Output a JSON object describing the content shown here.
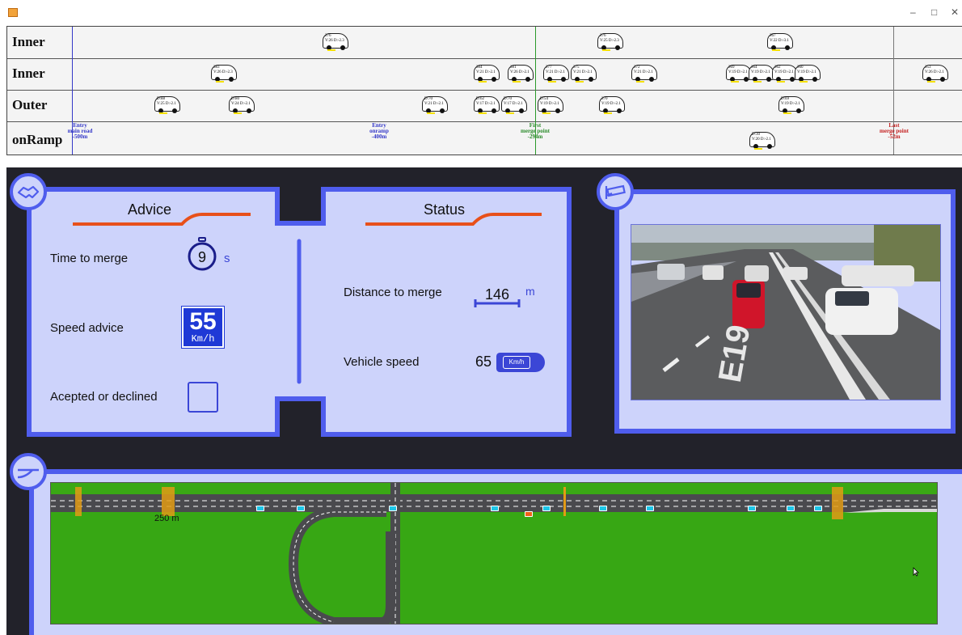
{
  "window": {
    "controls": [
      "–",
      "□",
      "✕"
    ]
  },
  "lanes": {
    "labels": [
      "Inner",
      "Inner",
      "Outer",
      "onRamp"
    ],
    "markers": [
      {
        "lines": [
          "Entry",
          "main road",
          "-500m"
        ],
        "color": "#3438c8"
      },
      {
        "lines": [
          "Entry",
          "onramp",
          "-400m"
        ],
        "color": "#3438c8"
      },
      {
        "lines": [
          "First",
          "merge point",
          "-294m"
        ],
        "color": "#2a8a2a"
      },
      {
        "lines": [
          "Last",
          "merge point",
          "-52m"
        ],
        "color": "#c42020"
      }
    ],
    "cars": [
      {
        "lane": 0,
        "l1": "376",
        "l2": "V:26 D:-2.3"
      },
      {
        "lane": 0,
        "l1": "376",
        "l2": "V:25 D:-2.3"
      },
      {
        "lane": 0,
        "l1": "367",
        "l2": "V:22 D:-3.1"
      },
      {
        "lane": 1,
        "l1": "383",
        "l2": "V:26 D:-2.3"
      },
      {
        "lane": 1,
        "l1": "384",
        "l2": "V:21 D:-2.1"
      },
      {
        "lane": 1,
        "l1": "381",
        "l2": "V:26 D:-2.1"
      },
      {
        "lane": 1,
        "l1": "377",
        "l2": "V:21 D:-2.1"
      },
      {
        "lane": 1,
        "l1": "375",
        "l2": "V:21 D:-2.1"
      },
      {
        "lane": 1,
        "l1": "372",
        "l2": "V:21 D:-2.1"
      },
      {
        "lane": 1,
        "l1": "369",
        "l2": "V:19 D:-2.1"
      },
      {
        "lane": 1,
        "l1": "364",
        "l2": "V:19 D:-2.1"
      },
      {
        "lane": 1,
        "l1": "362",
        "l2": "V:19 D:-2.1"
      },
      {
        "lane": 1,
        "l1": "360",
        "l2": "V:19 D:-2.1"
      },
      {
        "lane": 1,
        "l1": "353",
        "l2": "V:26 D:-2.1"
      },
      {
        "lane": 2,
        "l1": "D:88",
        "l2": "V:25 D:-2.1"
      },
      {
        "lane": 2,
        "l1": "D:80",
        "l2": "V:24 D:-2.1"
      },
      {
        "lane": 2,
        "l1": "D:70",
        "l2": "V:21 D:-2.1"
      },
      {
        "lane": 2,
        "l1": "D:62",
        "l2": "V:17 D:-2.1"
      },
      {
        "lane": 2,
        "l1": "D:70",
        "l2": "V:17 D:-2.1"
      },
      {
        "lane": 2,
        "l1": "D:54",
        "l2": "V:19 D:-2.1"
      },
      {
        "lane": 2,
        "l1": "370",
        "l2": "V:19 D:-2.1"
      },
      {
        "lane": 2,
        "l1": "D:69",
        "l2": "V:19 D:-2.1"
      },
      {
        "lane": 3,
        "l1": "D:30",
        "l2": "V:20 D:-2.1"
      }
    ]
  },
  "advice": {
    "title": "Advice",
    "time_label": "Time to merge",
    "time_value": "9",
    "time_unit": "s",
    "speed_label": "Speed advice",
    "speed_value": "55",
    "speed_unit": "Km/h",
    "accept_label": "Acepted or declined"
  },
  "status": {
    "title": "Status",
    "distance_label": "Distance to merge",
    "distance_value": "146",
    "distance_unit": "m",
    "speed_label": "Vehicle speed",
    "speed_value": "65",
    "speed_unit": "Km/h"
  },
  "camera": {
    "road_marking": "E19"
  },
  "map": {
    "scale_label": "250 m"
  },
  "colors": {
    "accent_blue": "#4f5ded",
    "panel_fill": "#cdd3fb",
    "orange_line": "#e8501a",
    "grass": "#37a714",
    "dashboard_bg": "#22222a"
  },
  "icons": {
    "advice_badge": "handshake-icon",
    "camera_badge": "security-camera-icon",
    "map_badge": "road-merge-icon"
  }
}
